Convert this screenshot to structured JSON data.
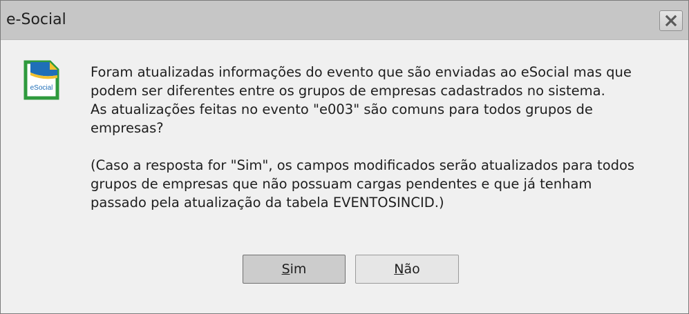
{
  "window": {
    "title": "e-Social",
    "close_symbol": "X"
  },
  "icon": {
    "name": "esocial-icon",
    "label": "eSocial"
  },
  "message": {
    "lines": [
      "Foram atualizadas informações do evento que são enviadas ao eSocial mas que",
      "podem ser diferentes entre os grupos de empresas cadastrados no sistema.",
      "As atualizações feitas no evento \"e003\" são comuns para todos grupos de",
      "empresas?"
    ],
    "note_lines": [
      "(Caso a resposta for \"Sim\", os campos modificados serão atualizados para todos",
      "grupos de empresas que não possuam cargas pendentes e que já tenham",
      "passado pela atualização da tabela EVENTOSINCID.)"
    ]
  },
  "buttons": {
    "yes": {
      "mnemonic": "S",
      "rest": "im"
    },
    "no": {
      "mnemonic": "N",
      "rest": "ão"
    }
  },
  "colors": {
    "titlebar": "#c6c6c6",
    "body": "#f0f0f0",
    "icon_green": "#2e9a3d",
    "icon_blue": "#1f6fb8",
    "icon_yellow": "#f2c12e"
  }
}
